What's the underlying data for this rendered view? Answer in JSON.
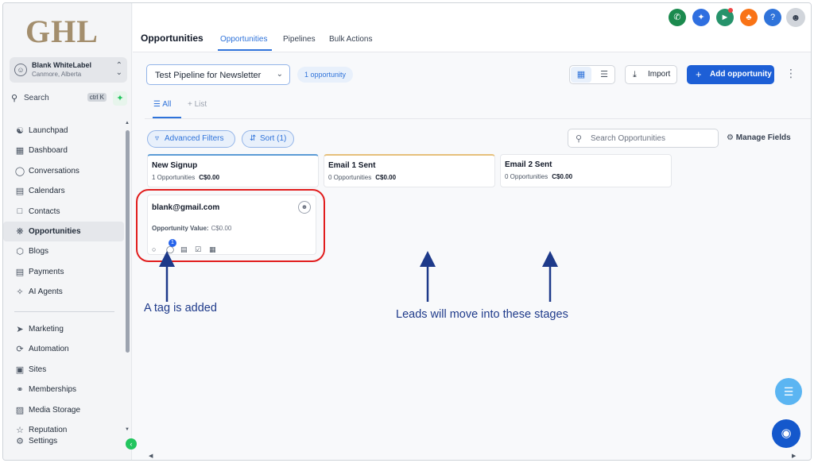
{
  "app": {
    "logo_text": "GHL"
  },
  "account": {
    "name": "Blank WhiteLabel",
    "location": "Canmore, Alberta"
  },
  "sidebar": {
    "search_label": "Search",
    "search_shortcut": "ctrl K",
    "items": [
      {
        "label": "Launchpad",
        "icon": "rocket-icon"
      },
      {
        "label": "Dashboard",
        "icon": "grid-icon"
      },
      {
        "label": "Conversations",
        "icon": "chat-icon"
      },
      {
        "label": "Calendars",
        "icon": "calendar-icon"
      },
      {
        "label": "Contacts",
        "icon": "contacts-icon"
      },
      {
        "label": "Opportunities",
        "icon": "opportunities-icon",
        "active": true
      },
      {
        "label": "Blogs",
        "icon": "cube-icon"
      },
      {
        "label": "Payments",
        "icon": "receipt-icon"
      },
      {
        "label": "AI Agents",
        "icon": "sparkle-icon"
      }
    ],
    "items2": [
      {
        "label": "Marketing",
        "icon": "send-icon"
      },
      {
        "label": "Automation",
        "icon": "automation-icon"
      },
      {
        "label": "Sites",
        "icon": "sites-icon"
      },
      {
        "label": "Memberships",
        "icon": "membership-icon"
      },
      {
        "label": "Media Storage",
        "icon": "image-icon"
      },
      {
        "label": "Reputation",
        "icon": "star-icon"
      },
      {
        "label": "Settings",
        "icon": "gear-icon"
      }
    ]
  },
  "header": {
    "title": "Opportunities",
    "tabs": [
      {
        "label": "Opportunities",
        "active": true
      },
      {
        "label": "Pipelines"
      },
      {
        "label": "Bulk Actions"
      }
    ],
    "icons": [
      {
        "name": "phone-icon",
        "color": "#1b8a4e"
      },
      {
        "name": "magic-icon",
        "color": "#2f6fe0"
      },
      {
        "name": "megaphone-icon",
        "color": "#26936b"
      },
      {
        "name": "bell-icon",
        "color": "#f97316"
      },
      {
        "name": "help-icon",
        "color": "#2f73da"
      }
    ]
  },
  "toolbar": {
    "pipeline": "Test Pipeline for Newsletter",
    "opportunity_count": "1 opportunity",
    "import_label": "Import",
    "add_label": "Add opportunity"
  },
  "views": {
    "all": "All",
    "add_list": "List"
  },
  "filters": {
    "advanced": "Advanced Filters",
    "sort": "Sort (1)",
    "search_placeholder": "Search Opportunities",
    "manage_fields": "Manage Fields"
  },
  "stages": [
    {
      "name": "New Signup",
      "count": "1 Opportunities",
      "value": "C$0.00",
      "accent": "#5b9bd5"
    },
    {
      "name": "Email 1 Sent",
      "count": "0 Opportunities",
      "value": "C$0.00",
      "accent": "#e6c07b"
    },
    {
      "name": "Email 2 Sent",
      "count": "0 Opportunities",
      "value": "C$0.00",
      "accent": "#e5e7eb"
    }
  ],
  "card": {
    "email": "blank@gmail.com",
    "value_label": "Opportunity Value:",
    "value": "C$0.00",
    "tag_count": "1"
  },
  "annotations": {
    "tag": "A tag is added",
    "leads": "Leads will move into these stages",
    "highlight_color": "#e11d1d",
    "arrow_color": "#1e3a8a"
  }
}
